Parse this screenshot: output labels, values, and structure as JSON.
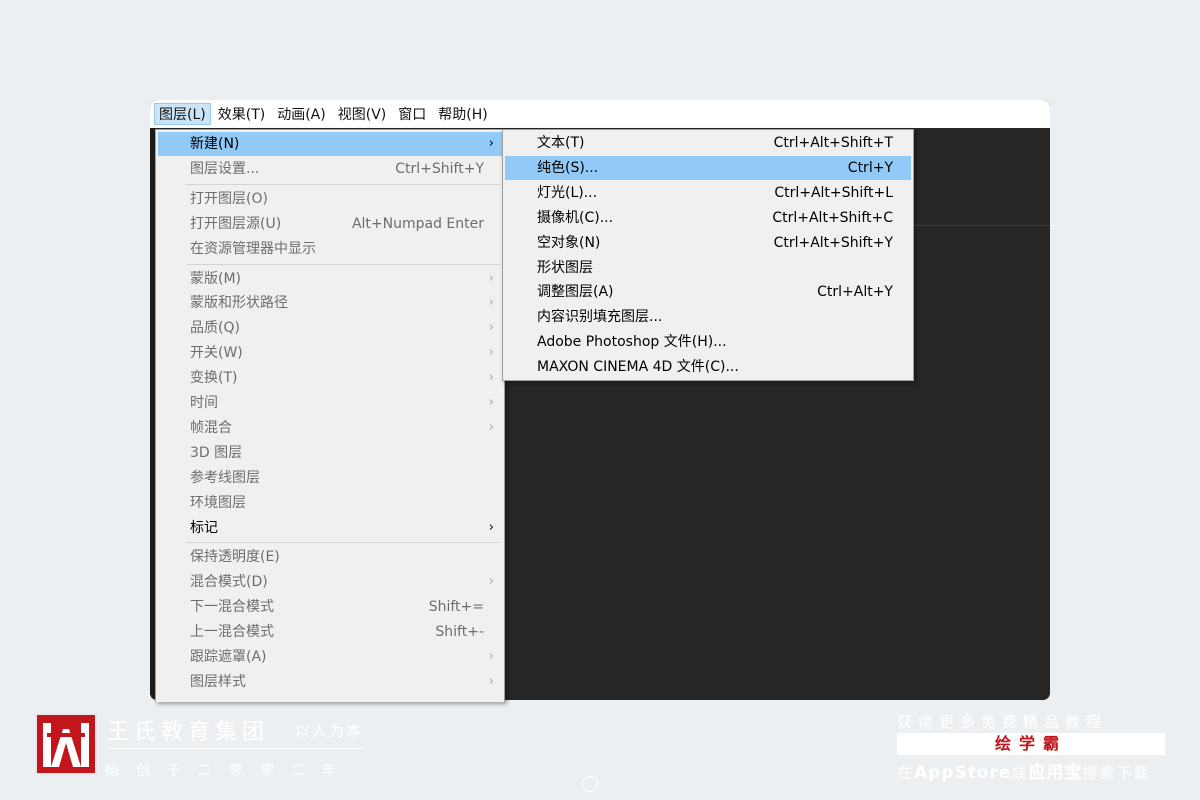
{
  "menubar": [
    {
      "label": "图层(L)",
      "active": true
    },
    {
      "label": "效果(T)",
      "active": false
    },
    {
      "label": "动画(A)",
      "active": false
    },
    {
      "label": "视图(V)",
      "active": false
    },
    {
      "label": "窗口",
      "active": false
    },
    {
      "label": "帮助(H)",
      "active": false
    }
  ],
  "layer_menu": {
    "items": [
      {
        "label": "新建(N)",
        "shortcut": "",
        "arrow": true,
        "highlight": true,
        "disabled": false
      },
      {
        "label": "图层设置...",
        "shortcut": "Ctrl+Shift+Y",
        "arrow": false,
        "highlight": false,
        "disabled": true
      },
      {
        "label": "打开图层(O)",
        "shortcut": "",
        "arrow": false,
        "highlight": false,
        "disabled": true
      },
      {
        "label": "打开图层源(U)",
        "shortcut": "Alt+Numpad Enter",
        "arrow": false,
        "highlight": false,
        "disabled": true
      },
      {
        "label": "在资源管理器中显示",
        "shortcut": "",
        "arrow": false,
        "highlight": false,
        "disabled": true
      },
      {
        "label": "蒙版(M)",
        "shortcut": "",
        "arrow": true,
        "highlight": false,
        "disabled": true
      },
      {
        "label": "蒙版和形状路径",
        "shortcut": "",
        "arrow": true,
        "highlight": false,
        "disabled": true
      },
      {
        "label": "品质(Q)",
        "shortcut": "",
        "arrow": true,
        "highlight": false,
        "disabled": true
      },
      {
        "label": "开关(W)",
        "shortcut": "",
        "arrow": true,
        "highlight": false,
        "disabled": true
      },
      {
        "label": "变换(T)",
        "shortcut": "",
        "arrow": true,
        "highlight": false,
        "disabled": true
      },
      {
        "label": "时间",
        "shortcut": "",
        "arrow": true,
        "highlight": false,
        "disabled": true
      },
      {
        "label": "帧混合",
        "shortcut": "",
        "arrow": true,
        "highlight": false,
        "disabled": true
      },
      {
        "label": "3D 图层",
        "shortcut": "",
        "arrow": false,
        "highlight": false,
        "disabled": true
      },
      {
        "label": "参考线图层",
        "shortcut": "",
        "arrow": false,
        "highlight": false,
        "disabled": true
      },
      {
        "label": "环境图层",
        "shortcut": "",
        "arrow": false,
        "highlight": false,
        "disabled": true
      },
      {
        "label": "标记",
        "shortcut": "",
        "arrow": true,
        "highlight": false,
        "disabled": false
      },
      {
        "label": "保持透明度(E)",
        "shortcut": "",
        "arrow": false,
        "highlight": false,
        "disabled": true
      },
      {
        "label": "混合模式(D)",
        "shortcut": "",
        "arrow": true,
        "highlight": false,
        "disabled": true
      },
      {
        "label": "下一混合模式",
        "shortcut": "Shift+=",
        "arrow": false,
        "highlight": false,
        "disabled": true
      },
      {
        "label": "上一混合模式",
        "shortcut": "Shift+-",
        "arrow": false,
        "highlight": false,
        "disabled": true
      },
      {
        "label": "跟踪遮罩(A)",
        "shortcut": "",
        "arrow": true,
        "highlight": false,
        "disabled": true
      },
      {
        "label": "图层样式",
        "shortcut": "",
        "arrow": true,
        "highlight": false,
        "disabled": true
      }
    ]
  },
  "new_submenu": {
    "items": [
      {
        "label": "文本(T)",
        "shortcut": "Ctrl+Alt+Shift+T",
        "highlight": false
      },
      {
        "label": "纯色(S)...",
        "shortcut": "Ctrl+Y",
        "highlight": true
      },
      {
        "label": "灯光(L)...",
        "shortcut": "Ctrl+Alt+Shift+L",
        "highlight": false
      },
      {
        "label": "摄像机(C)...",
        "shortcut": "Ctrl+Alt+Shift+C",
        "highlight": false
      },
      {
        "label": "空对象(N)",
        "shortcut": "Ctrl+Alt+Shift+Y",
        "highlight": false
      },
      {
        "label": "形状图层",
        "shortcut": "",
        "highlight": false
      },
      {
        "label": "调整图层(A)",
        "shortcut": "Ctrl+Alt+Y",
        "highlight": false
      },
      {
        "label": "内容识别填充图层...",
        "shortcut": "",
        "highlight": false
      },
      {
        "label": "Adobe Photoshop 文件(H)...",
        "shortcut": "",
        "highlight": false
      },
      {
        "label": "MAXON CINEMA 4D 文件(C)...",
        "shortcut": "",
        "highlight": false
      }
    ]
  },
  "arrow_glyph": "›",
  "watermark": {
    "brand": "王氏教育集团",
    "motto": "以人为本",
    "since": "始创于二零零二年",
    "promo_top": "获得更多免费精品教程",
    "promo_app": "绘学霸",
    "promo_bottom_pre": "在",
    "promo_bottom_store": "AppStore",
    "promo_bottom_mid": "或",
    "promo_bottom_yyb": "应用宝",
    "promo_bottom_post": "搜索下载"
  },
  "colors": {
    "brand_red": "#c3161c",
    "menu_highlight": "#91c9f7",
    "menubar_active": "#cce4f7",
    "app_dark": "#262626"
  }
}
